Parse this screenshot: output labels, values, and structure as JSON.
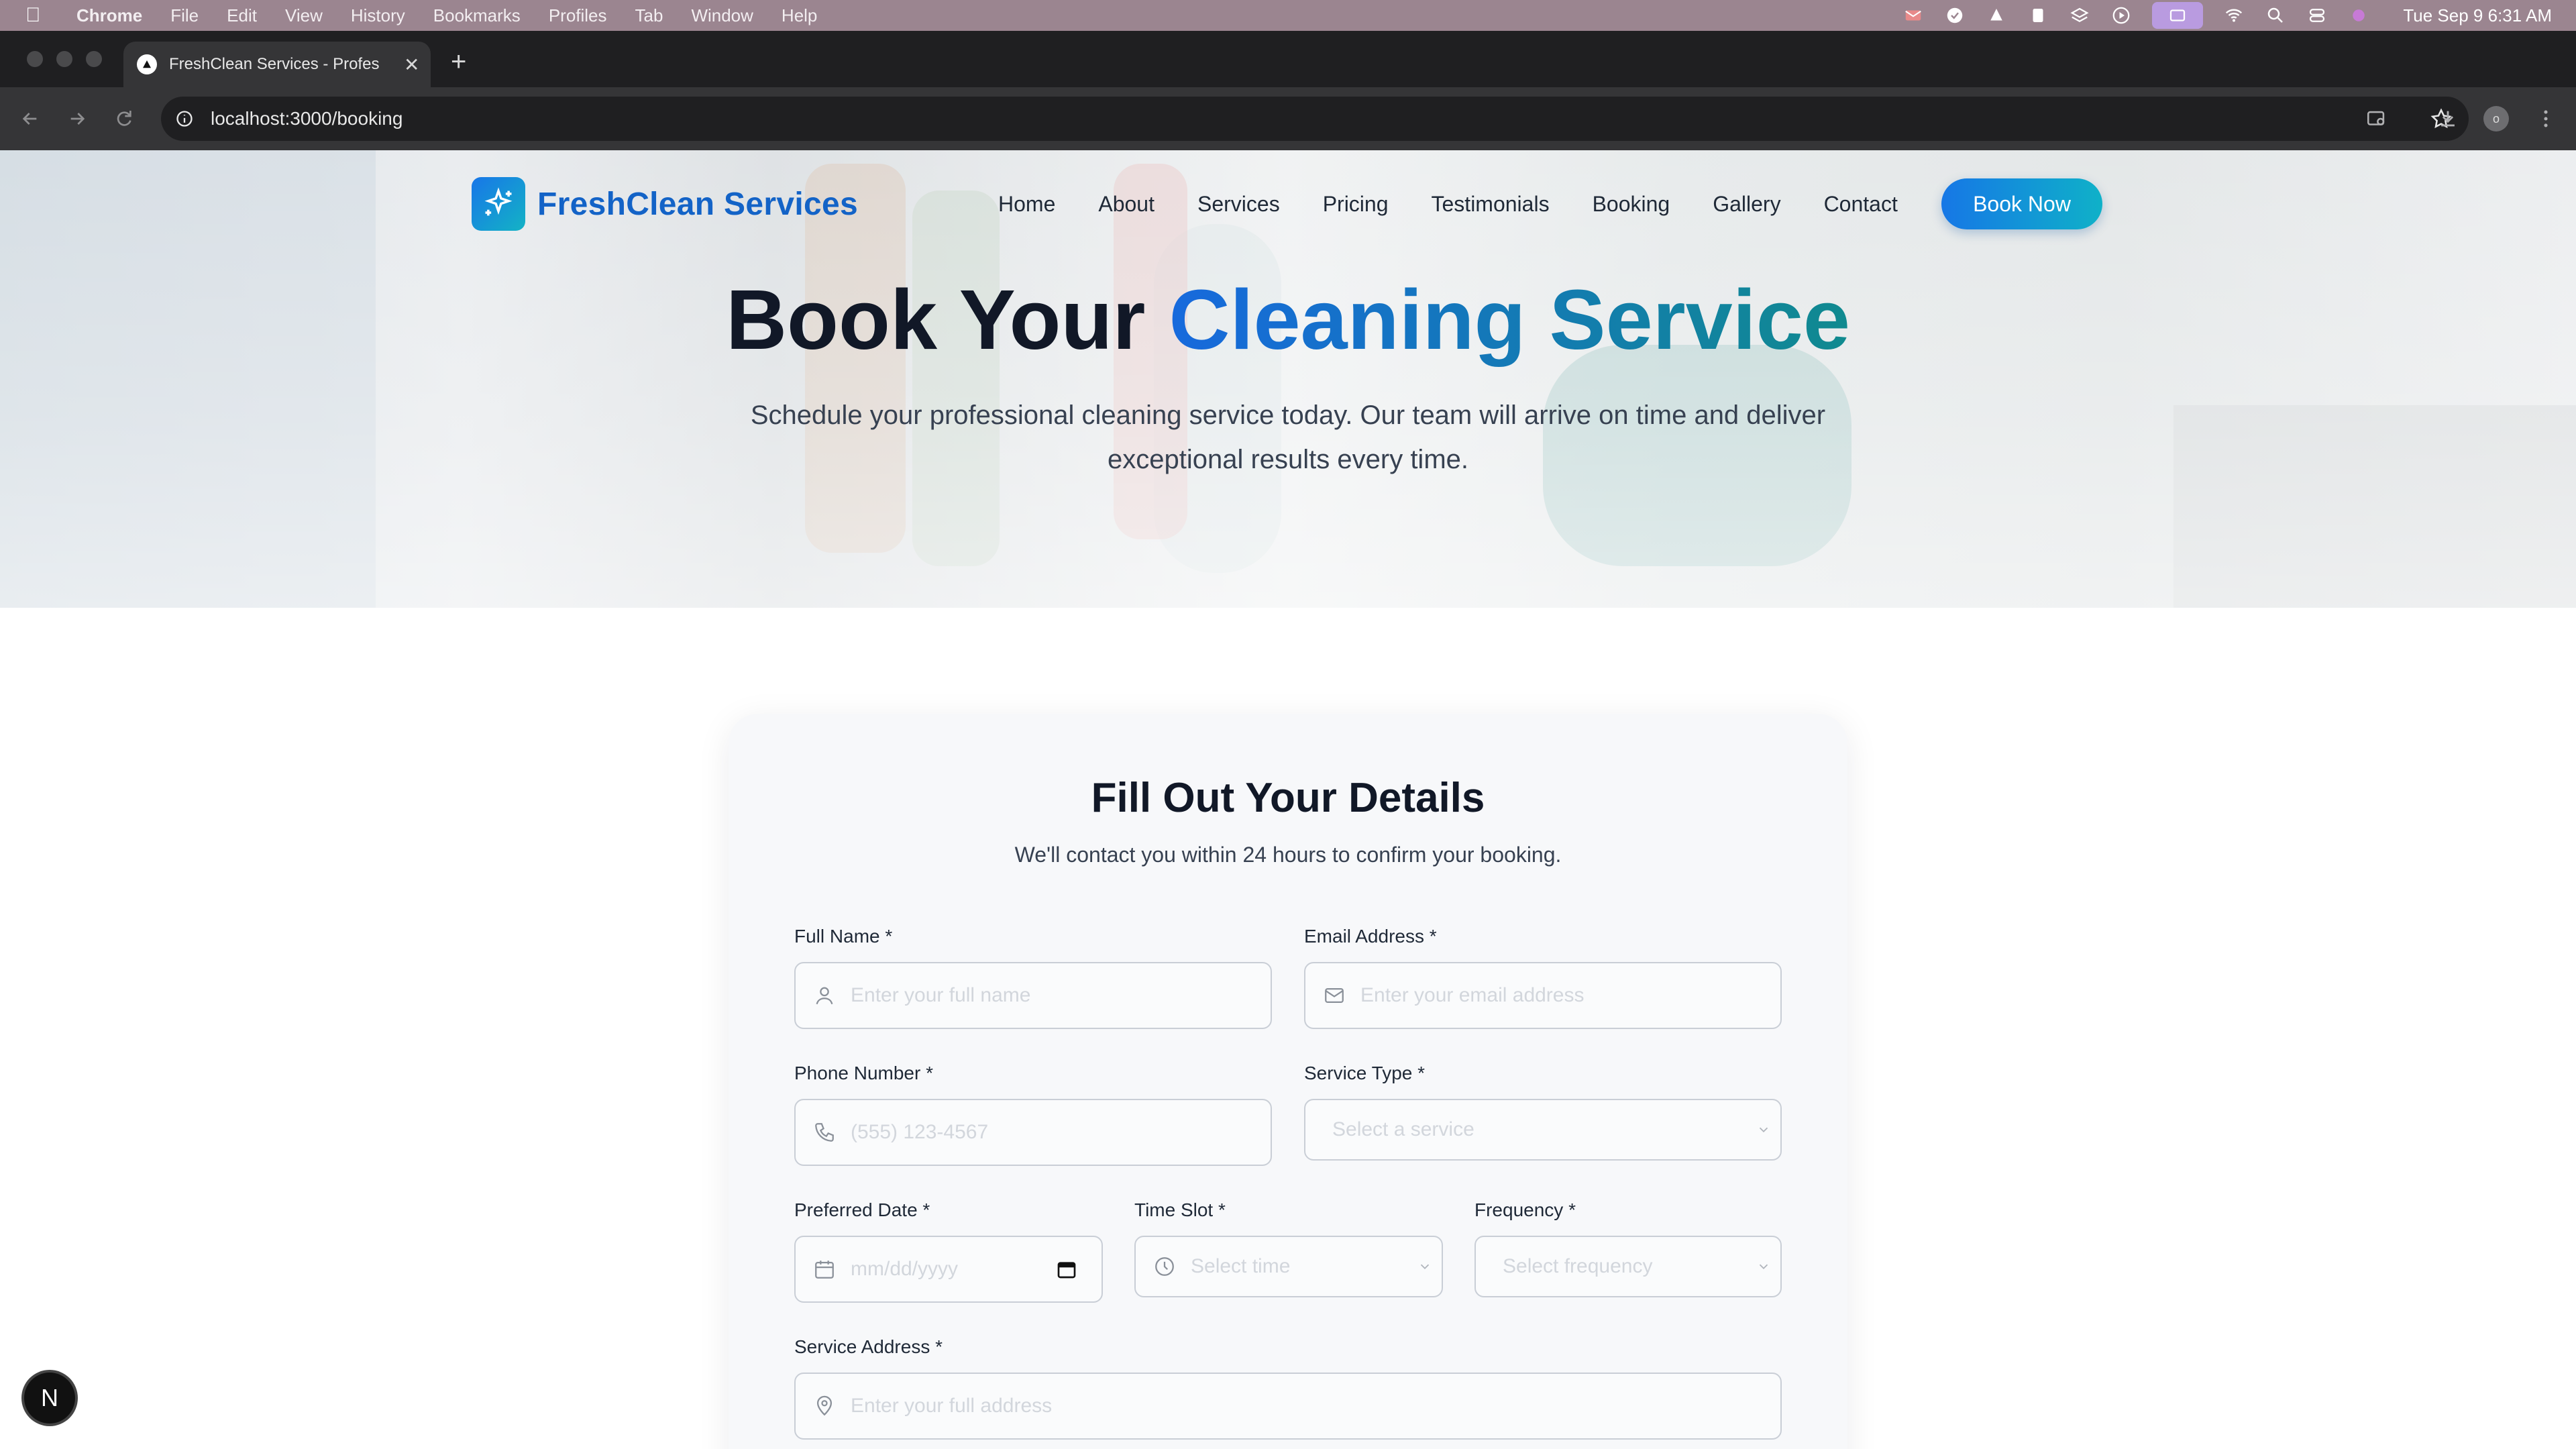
{
  "menubar": {
    "app": "Chrome",
    "items": [
      "File",
      "Edit",
      "View",
      "History",
      "Bookmarks",
      "Profiles",
      "Tab",
      "Window",
      "Help"
    ],
    "clock": "Tue Sep 9  6:31 AM"
  },
  "browser": {
    "tab_title": "FreshClean Services - Profes",
    "url": "localhost:3000/booking",
    "profile_initial": "o"
  },
  "site": {
    "brand": "FreshClean Services",
    "nav": [
      "Home",
      "About",
      "Services",
      "Pricing",
      "Testimonials",
      "Booking",
      "Gallery",
      "Contact"
    ],
    "cta": "Book Now"
  },
  "hero": {
    "title_plain": "Book Your",
    "title_accent": "Cleaning Service",
    "subtitle": "Schedule your professional cleaning service today. Our team will arrive on time and deliver exceptional results every time."
  },
  "form": {
    "title": "Fill Out Your Details",
    "subtitle": "We'll contact you within 24 hours to confirm your booking.",
    "full_name": {
      "label": "Full Name *",
      "placeholder": "Enter your full name"
    },
    "email": {
      "label": "Email Address *",
      "placeholder": "Enter your email address"
    },
    "phone": {
      "label": "Phone Number *",
      "placeholder": "(555) 123-4567"
    },
    "service_type": {
      "label": "Service Type *",
      "placeholder": "Select a service"
    },
    "date": {
      "label": "Preferred Date *",
      "placeholder": "mm/dd/yyyy"
    },
    "time_slot": {
      "label": "Time Slot *",
      "placeholder": "Select time"
    },
    "frequency": {
      "label": "Frequency *",
      "placeholder": "Select frequency"
    },
    "address": {
      "label": "Service Address *",
      "placeholder": "Enter your full address"
    }
  },
  "dev_badge": "N",
  "colors": {
    "brand_blue": "#1363c7",
    "cta_gradient_start": "#1677e6",
    "cta_gradient_end": "#0fb1c8",
    "menubar": "#9b8590"
  }
}
